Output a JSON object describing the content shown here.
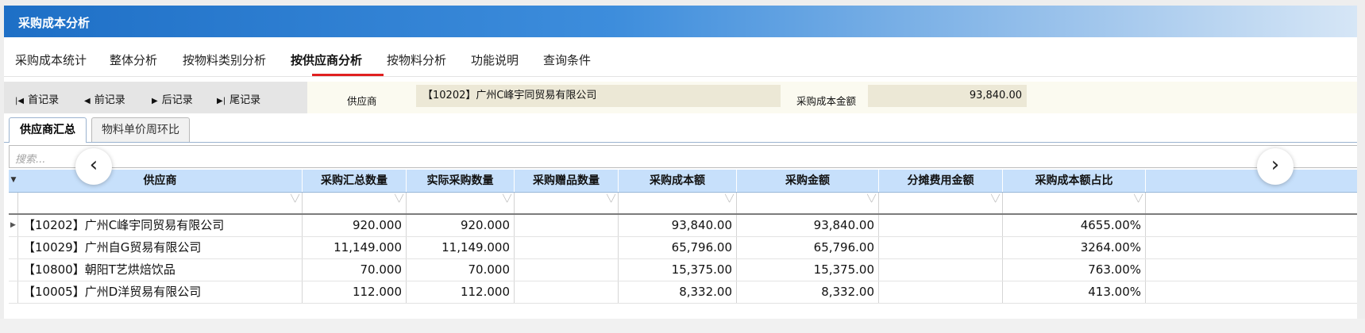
{
  "window": {
    "title": "采购成本分析"
  },
  "tabs": [
    {
      "label": "采购成本统计"
    },
    {
      "label": "整体分析"
    },
    {
      "label": "按物料类别分析"
    },
    {
      "label": "按供应商分析",
      "active": true
    },
    {
      "label": "按物料分析"
    },
    {
      "label": "功能说明"
    },
    {
      "label": "查询条件"
    }
  ],
  "nav": {
    "first": {
      "icon": "first-record-icon",
      "label": "首记录"
    },
    "prev": {
      "icon": "prev-record-icon",
      "label": "前记录"
    },
    "next": {
      "icon": "next-record-icon",
      "label": "后记录"
    },
    "last": {
      "icon": "last-record-icon",
      "label": "尾记录"
    }
  },
  "fields": {
    "supplier_label": "供应商",
    "supplier_value": "【10202】广州C峰宇同贸易有限公司",
    "amount_label": "采购成本金额",
    "amount_value": "93,840.00"
  },
  "subtabs": [
    {
      "label": "供应商汇总",
      "active": true
    },
    {
      "label": "物料单价周环比"
    }
  ],
  "search": {
    "placeholder": "搜索..."
  },
  "table": {
    "columns": [
      "供应商",
      "采购汇总数量",
      "实际采购数量",
      "采购赠品数量",
      "采购成本额",
      "采购金额",
      "分摊费用金额",
      "采购成本额占比"
    ],
    "rows": [
      [
        "【10202】广州C峰宇同贸易有限公司",
        "920.000",
        "920.000",
        "",
        "93,840.00",
        "93,840.00",
        "",
        "4655.00%"
      ],
      [
        "【10029】广州自G贸易有限公司",
        "11,149.000",
        "11,149.000",
        "",
        "65,796.00",
        "65,796.00",
        "",
        "3264.00%"
      ],
      [
        "【10800】朝阳T艺烘焙饮品",
        "70.000",
        "70.000",
        "",
        "15,375.00",
        "15,375.00",
        "",
        "763.00%"
      ],
      [
        "【10005】广州D洋贸易有限公司",
        "112.000",
        "112.000",
        "",
        "8,332.00",
        "8,332.00",
        "",
        "413.00%"
      ]
    ]
  },
  "carousel": {
    "prev_icon": "chevron-left-icon",
    "next_icon": "chevron-right-icon"
  },
  "colors": {
    "title_bar": "#1e6fc6",
    "active_tab_underline": "#e02020",
    "header_bg": "#c7e0fb"
  }
}
